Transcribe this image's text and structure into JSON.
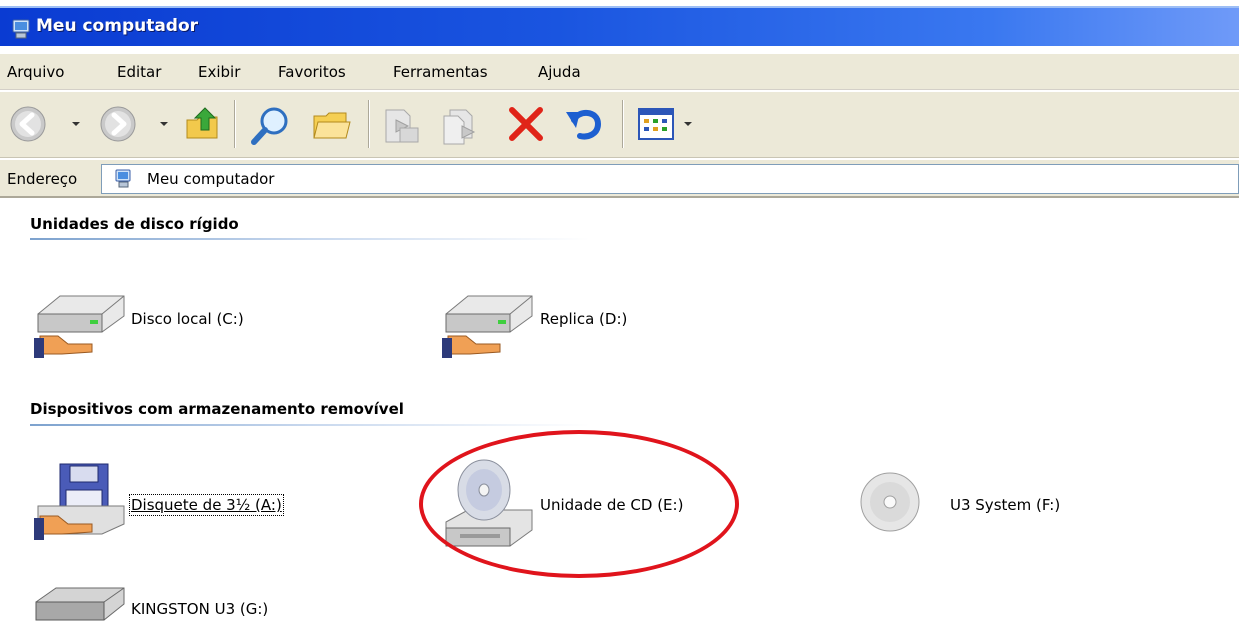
{
  "window": {
    "title": "Meu computador",
    "title_icon": "my-computer-icon"
  },
  "menu": {
    "items": [
      "Arquivo",
      "Editar",
      "Exibir",
      "Favoritos",
      "Ferramentas",
      "Ajuda"
    ]
  },
  "toolbar": {
    "buttons": [
      "back-icon",
      "forward-icon",
      "up-folder-icon",
      "search-icon",
      "folders-icon",
      "move-to-icon",
      "copy-to-icon",
      "delete-icon",
      "undo-icon",
      "views-icon"
    ]
  },
  "address": {
    "label": "Endereço",
    "value": "Meu computador",
    "icon": "my-computer-icon"
  },
  "sections": {
    "hard_disks": {
      "title": "Unidades de disco rígido",
      "drives": [
        {
          "label": "Disco local (C:)",
          "icon": "hard-drive-shared-icon"
        },
        {
          "label": "Replica (D:)",
          "icon": "hard-drive-shared-icon"
        }
      ]
    },
    "removable": {
      "title": "Dispositivos com armazenamento removível",
      "drives": [
        {
          "label": "Disquete de 3½ (A:)",
          "icon": "floppy-shared-icon"
        },
        {
          "label": "Unidade de CD (E:)",
          "icon": "cd-drive-icon"
        },
        {
          "label": "U3 System (F:)",
          "icon": "cd-icon"
        },
        {
          "label": "KINGSTON U3 (G:)",
          "icon": "usb-drive-icon"
        }
      ]
    }
  },
  "annotation": {
    "highlight_color": "#e0141c",
    "highlight_target": "Unidade de CD (E:)"
  }
}
